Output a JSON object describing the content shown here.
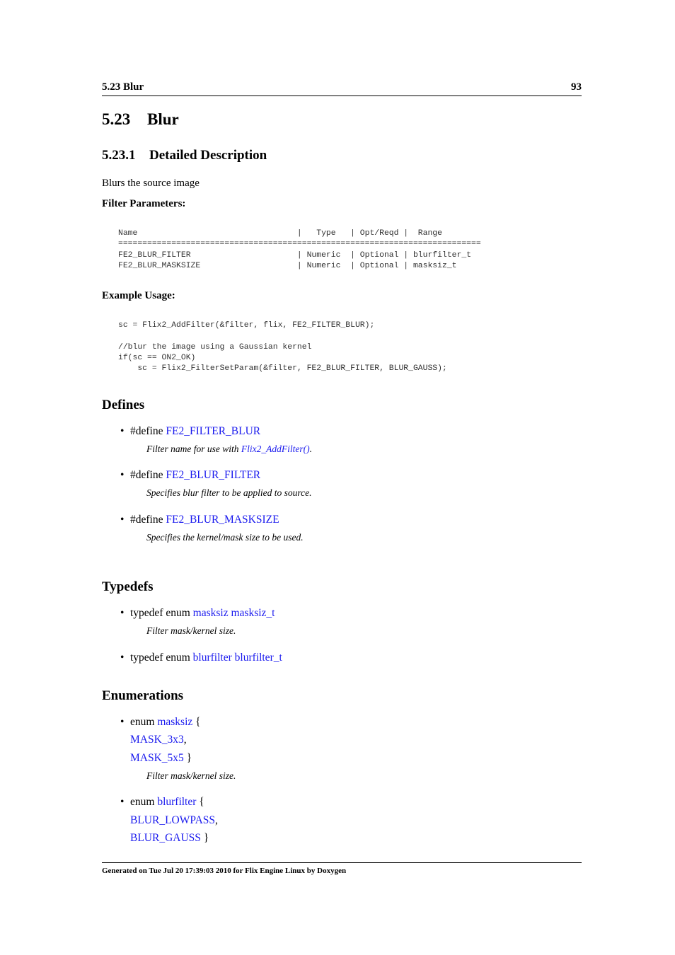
{
  "running_header": {
    "section": "5.23 Blur",
    "page_number": "93"
  },
  "title": {
    "number": "5.23",
    "text": "Blur"
  },
  "subsection": {
    "number": "5.23.1",
    "text": "Detailed Description"
  },
  "description": "Blurs the source image",
  "filter_params": {
    "label": "Filter Parameters:",
    "lines": [
      "Name                                 |   Type   | Opt/Reqd |  Range",
      "===========================================================================",
      "FE2_BLUR_FILTER                      | Numeric  | Optional | blurfilter_t",
      "FE2_BLUR_MASKSIZE                    | Numeric  | Optional | masksiz_t"
    ]
  },
  "example": {
    "label": "Example Usage:",
    "lines": [
      "sc = Flix2_AddFilter(&filter, flix, FE2_FILTER_BLUR);",
      "",
      "//blur the image using a Gaussian kernel",
      "if(sc == ON2_OK)",
      "    sc = Flix2_FilterSetParam(&filter, FE2_BLUR_FILTER, BLUR_GAUSS);"
    ]
  },
  "defines": {
    "heading": "Defines",
    "items": [
      {
        "prefix": "#define ",
        "name": "FE2_FILTER_BLUR",
        "desc_pre": "Filter name for use with ",
        "desc_link": "Flix2_AddFilter()",
        "desc_post": "."
      },
      {
        "prefix": "#define ",
        "name": "FE2_BLUR_FILTER",
        "desc_pre": "Specifies blur filter to be applied to source.",
        "desc_link": "",
        "desc_post": ""
      },
      {
        "prefix": "#define ",
        "name": "FE2_BLUR_MASKSIZE",
        "desc_pre": "Specifies the kernel/mask size to be used.",
        "desc_link": "",
        "desc_post": ""
      }
    ]
  },
  "typedefs": {
    "heading": "Typedefs",
    "items": [
      {
        "prefix": "typedef enum ",
        "name": "masksiz masksiz_t",
        "desc": "Filter mask/kernel size."
      },
      {
        "prefix": "typedef enum ",
        "name": "blurfilter blurfilter_t",
        "desc": ""
      }
    ]
  },
  "enumerations": {
    "heading": "Enumerations",
    "items": [
      {
        "prefix": "enum ",
        "name": "masksiz",
        "open": " {",
        "values": [
          "MASK_3x3",
          "MASK_5x5"
        ],
        "desc": "Filter mask/kernel size."
      },
      {
        "prefix": "enum ",
        "name": "blurfilter",
        "open": " {",
        "values": [
          "BLUR_LOWPASS",
          "BLUR_GAUSS"
        ],
        "desc": ""
      }
    ]
  },
  "footer": "Generated on Tue Jul 20 17:39:03 2010 for Flix Engine Linux by Doxygen",
  "colors": {
    "link": "#1a1aee",
    "text": "#000000",
    "code": "#333333"
  }
}
